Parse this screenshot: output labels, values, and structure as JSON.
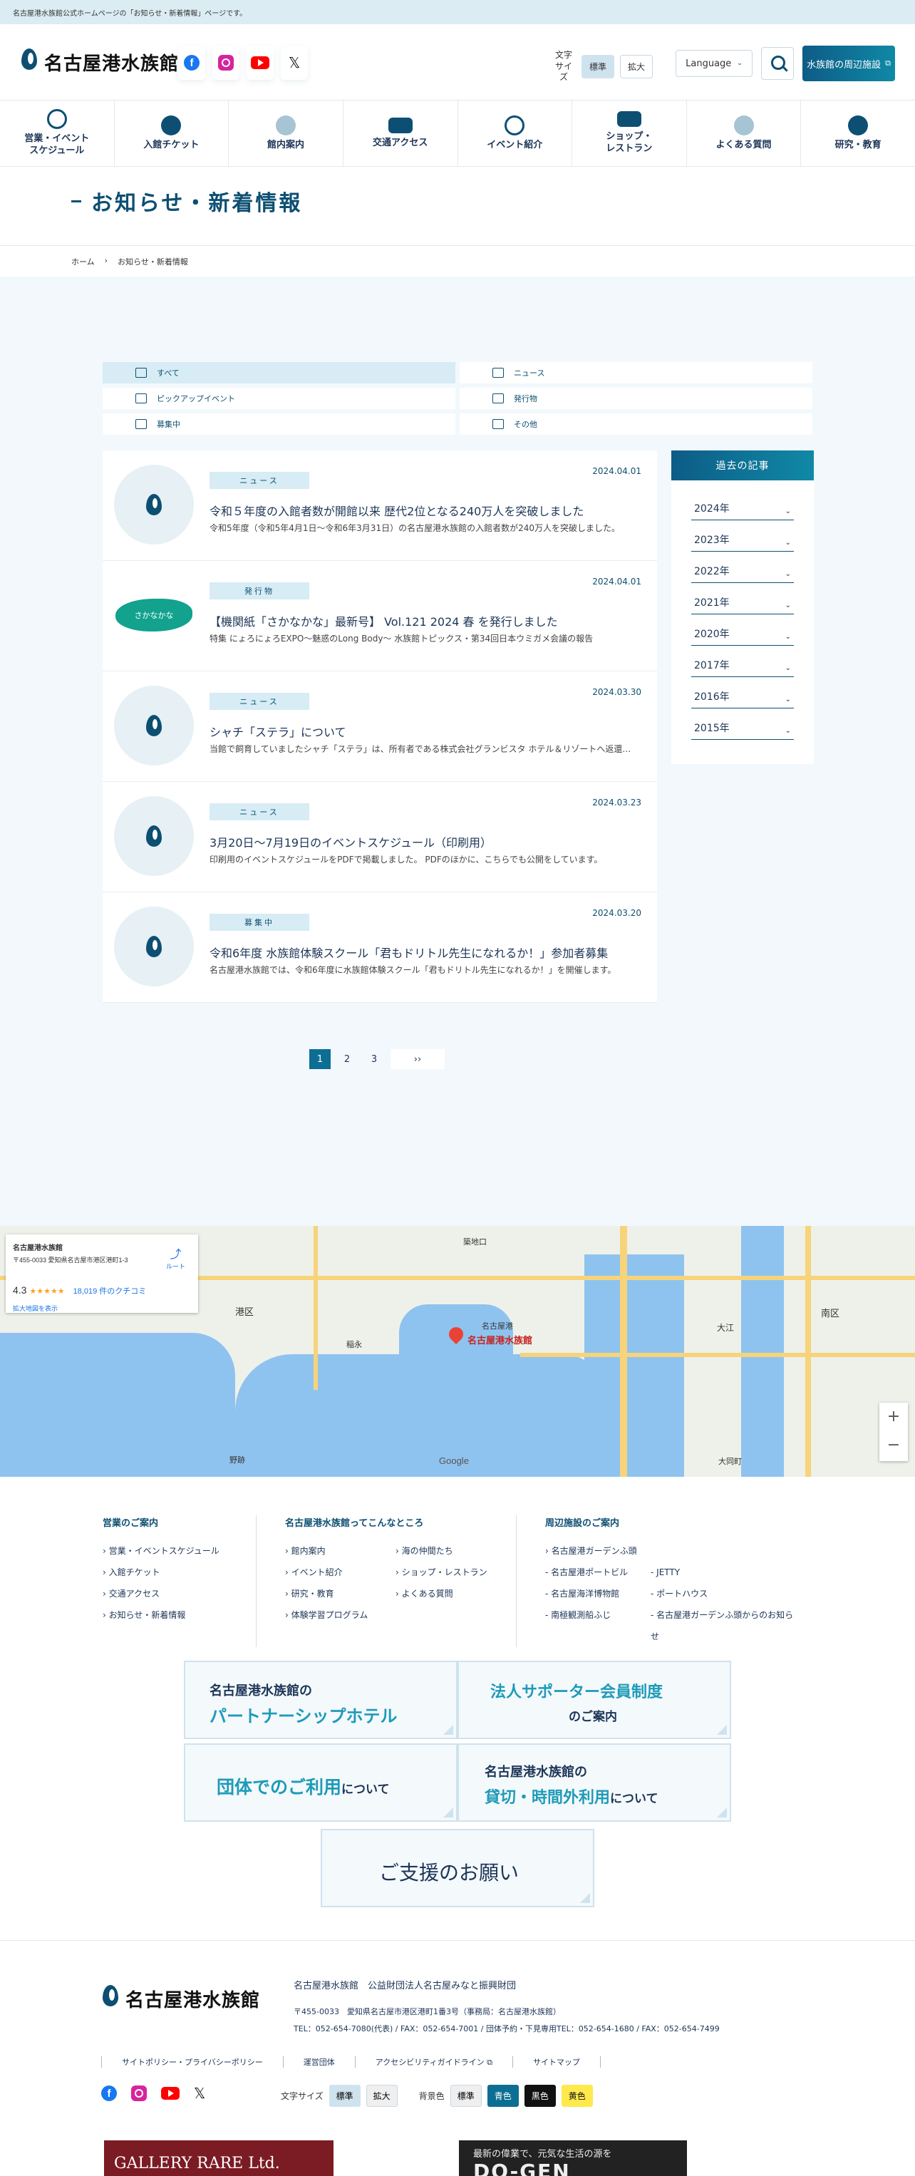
{
  "topbar": {
    "text": "名古屋港水族館公式ホームページの「お知らせ・新着情報」ページです。"
  },
  "header": {
    "logo_text": "名古屋港水族館",
    "logo_sub": "名古屋港水族館",
    "fontsize_label": "文字\nサイズ",
    "fontsize_standard": "標準",
    "fontsize_large": "拡大",
    "language_label": "Language",
    "nearby_label": "水族館の周辺施設"
  },
  "nav": [
    {
      "label": "営業・イベント\nスケジュール",
      "icon": "clock-icon"
    },
    {
      "label": "入館チケット",
      "icon": "yen-icon"
    },
    {
      "label": "館内案内",
      "icon": "map-search-icon"
    },
    {
      "label": "交通アクセス",
      "icon": "bus-icon"
    },
    {
      "label": "イベント紹介",
      "icon": "hand-icon"
    },
    {
      "label": "ショップ・\nレストラン",
      "icon": "shop-icon"
    },
    {
      "label": "よくある質問",
      "icon": "lightbulb-icon"
    },
    {
      "label": "研究・教育",
      "icon": "globe-icon"
    }
  ],
  "page": {
    "title": "お知らせ・新着情報",
    "breadcrumb_home": "ホーム",
    "breadcrumb_current": "お知らせ・新着情報"
  },
  "filters": [
    {
      "label": "すべて",
      "icon": "grid-icon",
      "active": true
    },
    {
      "label": "ニュース",
      "icon": "document-icon",
      "active": false
    },
    {
      "label": "ピックアップイベント",
      "icon": "screen-icon",
      "active": false
    },
    {
      "label": "発行物",
      "icon": "book-icon",
      "active": false
    },
    {
      "label": "募集中",
      "icon": "megaphone-icon",
      "active": false
    },
    {
      "label": "その他",
      "icon": "hand-pointer-icon",
      "active": false
    }
  ],
  "news": [
    {
      "date": "2024.04.01",
      "tag": "ニュース",
      "title": "令和５年度の入館者数が開館以来 歴代2位となる240万人を突破しました",
      "desc": "令和5年度（令和5年4月1日〜令和6年3月31日）の名古屋港水族館の入館者数が240万人を突破しました。",
      "thumb": "logo"
    },
    {
      "date": "2024.04.01",
      "tag": "発行物",
      "title": "【機関紙「さかなかな」最新号】 Vol.121 2024 春 を発行しました",
      "desc": "特集 にょろにょろEXPO〜魅惑のLong Body〜 水族館トピックス・第34回日本ウミガメ会議の報告",
      "thumb": "sakana",
      "thumb_text": "さかなかな"
    },
    {
      "date": "2024.03.30",
      "tag": "ニュース",
      "title": "シャチ「ステラ」について",
      "desc": "当館で飼育していましたシャチ「ステラ」は、所有者である株式会社グランビスタ ホテル＆リゾートへ返還しました。",
      "thumb": "logo"
    },
    {
      "date": "2024.03.23",
      "tag": "ニュース",
      "title": "3月20日〜7月19日のイベントスケジュール（印刷用）",
      "desc": "印刷用のイベントスケジュールをPDFで掲載しました。 PDFのほかに、こちらでも公開をしています。",
      "thumb": "logo"
    },
    {
      "date": "2024.03.20",
      "tag": "募集中",
      "title": "令和6年度 水族館体験スクール「君もドリトル先生になれるか！」参加者募集",
      "desc": "名古屋港水族館では、令和6年度に水族館体験スクール「君もドリトル先生になれるか！」を開催します。",
      "thumb": "logo"
    }
  ],
  "archive": {
    "heading": "過去の記事",
    "years": [
      "2024年",
      "2023年",
      "2022年",
      "2021年",
      "2020年",
      "2017年",
      "2016年",
      "2015年"
    ]
  },
  "pagination": {
    "pages": [
      "1",
      "2",
      "3"
    ],
    "current": "1",
    "next": "››"
  },
  "map": {
    "card_title": "名古屋港水族館",
    "card_addr": "〒455-0033 愛知県名古屋市港区港町1-3",
    "card_rating": "4.3",
    "card_stars": "★★★★★",
    "card_reviews": "18,019 件のクチコミ",
    "card_link": "拡大地図を表示",
    "card_route": "ルート",
    "pin_label": "名古屋港水族館",
    "zoom_in": "+",
    "zoom_out": "−",
    "google": "Google",
    "labels": [
      "港区",
      "稲永",
      "築地口",
      "名古屋港",
      "大江",
      "南区",
      "野跡",
      "大同町"
    ]
  },
  "footer_links": {
    "col1_head": "営業のご案内",
    "col1": [
      "営業・イベントスケジュール",
      "入館チケット",
      "交通アクセス",
      "お知らせ・新着情報"
    ],
    "col2_head": "名古屋港水族館ってこんなところ",
    "col2": [
      "館内案内",
      "海の仲間たち",
      "イベント紹介",
      "ショップ・レストラン",
      "研究・教育",
      "よくある質問",
      "体験学習プログラム"
    ],
    "col3_head": "周辺施設のご案内",
    "col3": [
      "名古屋港ガーデンふ頭",
      "",
      "名古屋港ポートビル",
      "JETTY",
      "名古屋海洋博物館",
      "ポートハウス",
      "南極観測船ふじ",
      "名古屋港ガーデンふ頭からのお知らせ"
    ]
  },
  "banners": {
    "b1_line1": "名古屋港水族館の",
    "b1_line2": "パートナーシップホテル",
    "b2_line1": "法人サポーター会員制度",
    "b2_line2": "のご案内",
    "b3_hl": "団体でのご利用",
    "b3_rest": "について",
    "b4_line1": "名古屋港水族館の",
    "b4_hl": "貸切・時間外利用",
    "b4_rest": "について",
    "b5": "ご支援のお願い"
  },
  "footer": {
    "logo_text": "名古屋港水族館",
    "org": "名古屋港水族館　公益財団法人名古屋みなと振興財団",
    "addr1": "〒455-0033　愛知県名古屋市港区港町1番3号（事務局：名古屋港水族館）",
    "addr2": "TEL：052-654-7080(代表) / FAX：052-654-7001 / 団体予約・下見専用TEL：052-654-1680 / FAX：052-654-7499",
    "links": [
      "サイトポリシー・プライバシーポリシー",
      "運営団体",
      "アクセシビリティガイドライン",
      "サイトマップ"
    ],
    "fontsize_label": "文字サイズ",
    "fontsize_standard": "標準",
    "fontsize_large": "拡大",
    "bg_label": "背景色",
    "bg_standard": "標準",
    "bg_blue": "青色",
    "bg_black": "黒色",
    "bg_yellow": "黄色",
    "ad1": "GALLERY RARE Ltd.",
    "ad2_line1": "最新の偉業で、元気な生活の源を",
    "ad2_line2": "DO-GEN"
  }
}
